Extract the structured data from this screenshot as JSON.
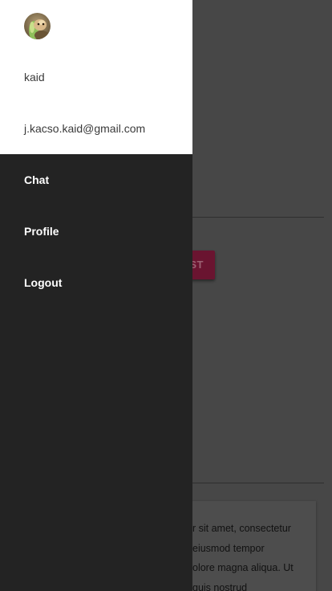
{
  "drawer": {
    "user": {
      "name": "kaid",
      "email": "j.kacso.kaid@gmail.com",
      "avatar_icon": "user-avatar"
    },
    "menu": [
      {
        "label": "Chat"
      },
      {
        "label": "Profile"
      },
      {
        "label": "Logout"
      }
    ]
  },
  "background_page": {
    "button_label": "ST",
    "card_lines": [
      "r sit amet, consectetur",
      "eiusmod tempor",
      "olore magna aliqua. Ut",
      "quis nostrud"
    ]
  },
  "colors": {
    "drawer_bg": "#232323",
    "header_bg": "#ffffff",
    "overlay_bg": "#474747",
    "accent_button": "#6a1430"
  }
}
